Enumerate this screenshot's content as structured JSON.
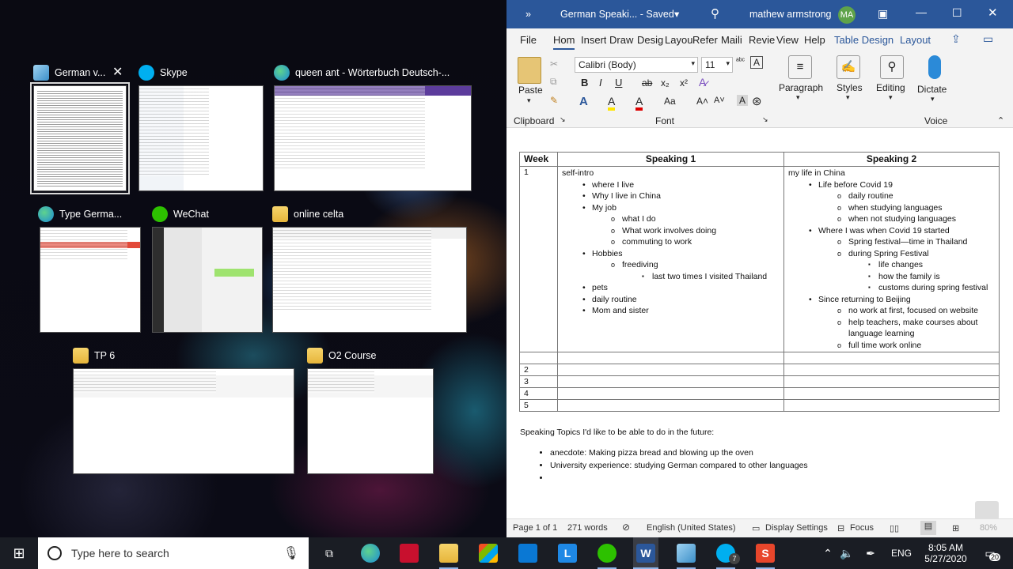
{
  "task_view": {
    "tiles": [
      {
        "name": "German v...",
        "icon": "notepad-icon",
        "close": "✕"
      },
      {
        "name": "Skype",
        "icon": "skype-icon"
      },
      {
        "name": "queen ant - Wörterbuch Deutsch-...",
        "icon": "edge-icon"
      },
      {
        "name": "Type Germa...",
        "icon": "edge-icon"
      },
      {
        "name": "WeChat",
        "icon": "wechat-icon"
      },
      {
        "name": "online celta",
        "icon": "folder-icon"
      },
      {
        "name": "TP 6",
        "icon": "folder-icon"
      },
      {
        "name": "O2 Course",
        "icon": "folder-icon"
      }
    ]
  },
  "word": {
    "titlebar": {
      "more": "»",
      "doc_title": "German Speaki... - Saved",
      "user": "mathew armstrong",
      "initials": "MA"
    },
    "tabs": [
      "File",
      "Hom",
      "Insert",
      "Draw",
      "Desig",
      "Layou",
      "Refer",
      "Maili",
      "Revie",
      "View",
      "Help",
      "Table Design",
      "Layout"
    ],
    "ribbon": {
      "paste": "Paste",
      "clipboard": "Clipboard",
      "font_name": "Calibri (Body)",
      "font_size": "11",
      "font_group": "Font",
      "paragraph": "Paragraph",
      "styles": "Styles",
      "editing": "Editing",
      "dictate": "Dictate",
      "voice": "Voice",
      "bold": "B",
      "italic": "I",
      "underline": "U",
      "strike": "ab",
      "sub": "x₂",
      "sup": "x²",
      "font_color": "A",
      "highlight": "A",
      "grow": "A^",
      "shrink": "Aᵛ",
      "case": "Aa"
    },
    "table": {
      "headers": [
        "Week",
        "Speaking 1",
        "Speaking 2"
      ],
      "week1": "1",
      "speaking1": [
        {
          "lvl": 0,
          "t": "self-intro"
        },
        {
          "lvl": 1,
          "t": "where I live"
        },
        {
          "lvl": 1,
          "t": "Why I live in China"
        },
        {
          "lvl": 1,
          "t": "My job"
        },
        {
          "lvl": 2,
          "t": "what I do"
        },
        {
          "lvl": 2,
          "t": "What work involves doing"
        },
        {
          "lvl": 2,
          "t": "commuting to work"
        },
        {
          "lvl": 1,
          "t": "Hobbies"
        },
        {
          "lvl": 2,
          "t": "freediving"
        },
        {
          "lvl": 3,
          "t": "last two times I visited Thailand"
        },
        {
          "lvl": 1,
          "t": "pets"
        },
        {
          "lvl": 1,
          "t": "daily routine"
        },
        {
          "lvl": 1,
          "t": "Mom and sister"
        }
      ],
      "speaking2": [
        {
          "lvl": 0,
          "t": "my life in China"
        },
        {
          "lvl": 1,
          "t": "Life before Covid 19"
        },
        {
          "lvl": 2,
          "t": "daily routine"
        },
        {
          "lvl": 2,
          "t": "when studying languages"
        },
        {
          "lvl": 2,
          "t": "when not studying languages"
        },
        {
          "lvl": 1,
          "t": "Where I was when Covid 19 started"
        },
        {
          "lvl": 2,
          "t": "Spring festival—time in Thailand"
        },
        {
          "lvl": 2,
          "t": "during Spring Festival"
        },
        {
          "lvl": 3,
          "t": "life changes"
        },
        {
          "lvl": 3,
          "t": "how the family is"
        },
        {
          "lvl": 3,
          "t": "customs during spring festival"
        },
        {
          "lvl": 1,
          "t": "Since returning to Beijing"
        },
        {
          "lvl": 2,
          "t": "no work at first, focused on website"
        },
        {
          "lvl": 2,
          "t": "help teachers, make courses about language learning"
        },
        {
          "lvl": 2,
          "t": "full time work online"
        }
      ],
      "weeks": [
        "2",
        "3",
        "4",
        "5"
      ]
    },
    "future_heading": "Speaking Topics I'd like to be able to do in the future:",
    "future_items": [
      "anecdote: Making pizza bread and blowing up the oven",
      "University experience: studying German compared to other languages",
      ""
    ],
    "status": {
      "page": "Page 1 of 1",
      "words": "271 words",
      "lang": "English (United States)",
      "display": "Display Settings",
      "focus": "Focus",
      "zoom": "80%"
    }
  },
  "taskbar": {
    "search_placeholder": "Type here to search",
    "time": "8:05 AM",
    "date": "5/27/2020",
    "lang": "ENG",
    "notifications": "20",
    "skype_badge": "7"
  }
}
